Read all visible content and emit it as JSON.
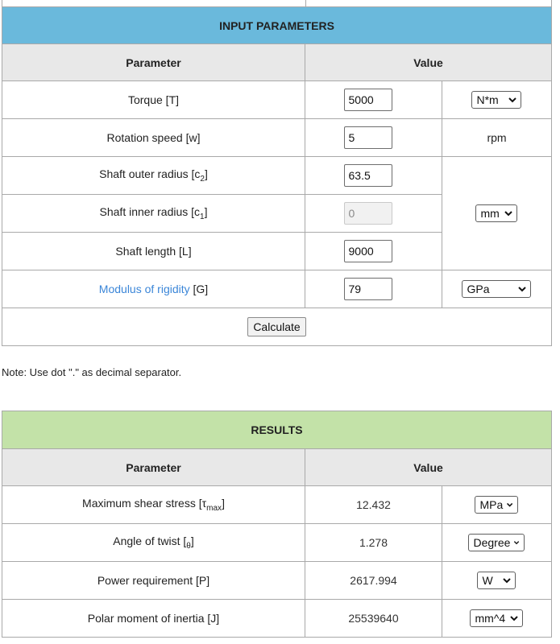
{
  "input": {
    "title": "INPUT PARAMETERS",
    "header_parameter": "Parameter",
    "header_value": "Value",
    "rows": [
      {
        "label": "Torque [T]",
        "value": "5000",
        "unit": "N*m"
      },
      {
        "label": "Rotation speed [w]",
        "value": "5",
        "unit": "rpm"
      },
      {
        "label_main": "Shaft outer radius [c",
        "label_sub": "2",
        "label_end": "]",
        "value": "63.5"
      },
      {
        "label_main": "Shaft inner radius [c",
        "label_sub": "1",
        "label_end": "]",
        "value": "0"
      },
      {
        "label": "Shaft length [L]",
        "value": "9000"
      },
      {
        "link_text": "Modulus of rigidity",
        "label_rest": " [G]",
        "value": "79",
        "unit": "GPa"
      }
    ],
    "length_unit": "mm",
    "calculate_label": "Calculate"
  },
  "note": "Note: Use dot \".\" as decimal separator.",
  "results": {
    "title": "RESULTS",
    "header_parameter": "Parameter",
    "header_value": "Value",
    "rows": [
      {
        "label_main": "Maximum shear stress [τ",
        "label_sub": "max",
        "label_end": "]",
        "value": "12.432",
        "unit": "MPa"
      },
      {
        "label_main": "Angle of twist [",
        "label_sub": "θ",
        "label_end": "]",
        "value": "1.278",
        "unit": "Degree"
      },
      {
        "label": "Power requirement [P]",
        "value": "2617.994",
        "unit": "W"
      },
      {
        "label": "Polar moment of inertia [J]",
        "value": "25539640",
        "unit": "mm^4"
      }
    ]
  },
  "icons": {
    "dropdown": "chevron-down-icon"
  }
}
